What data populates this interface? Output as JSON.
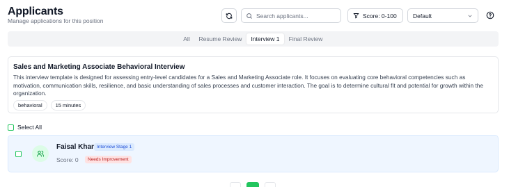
{
  "header": {
    "title": "Applicants",
    "subtitle": "Manage applications for this position"
  },
  "toolbar": {
    "search_placeholder": "Search applicants...",
    "score_label": "Score: 0-100",
    "sort_value": "Default"
  },
  "tabs": [
    {
      "label": "All",
      "active": false
    },
    {
      "label": "Resume Review",
      "active": false
    },
    {
      "label": "Interview 1",
      "active": true
    },
    {
      "label": "Final Review",
      "active": false
    }
  ],
  "template_card": {
    "title": "Sales and Marketing Associate Behavioral Interview",
    "description": "This interview template is designed for assessing entry-level candidates for a Sales and Marketing Associate role. It focuses on evaluating core behavioral competencies such as motivation, communication skills, resilience, and basic understanding of sales processes and customer interaction. The goal is to determine cultural fit and potential for growth within the organization.",
    "tags": [
      "behavioral",
      "15 minutes"
    ]
  },
  "list": {
    "select_all_label": "Select All",
    "applicants": [
      {
        "name": "Faisal Khan",
        "stage": "Interview Stage 1",
        "score": "Score: 0",
        "status": "Needs Improvement"
      }
    ]
  },
  "colors": {
    "accent": "#22c55e",
    "row_highlight": "#eff6ff",
    "stage_badge": "#dbeafe",
    "status_badge": "#fee2e2"
  }
}
